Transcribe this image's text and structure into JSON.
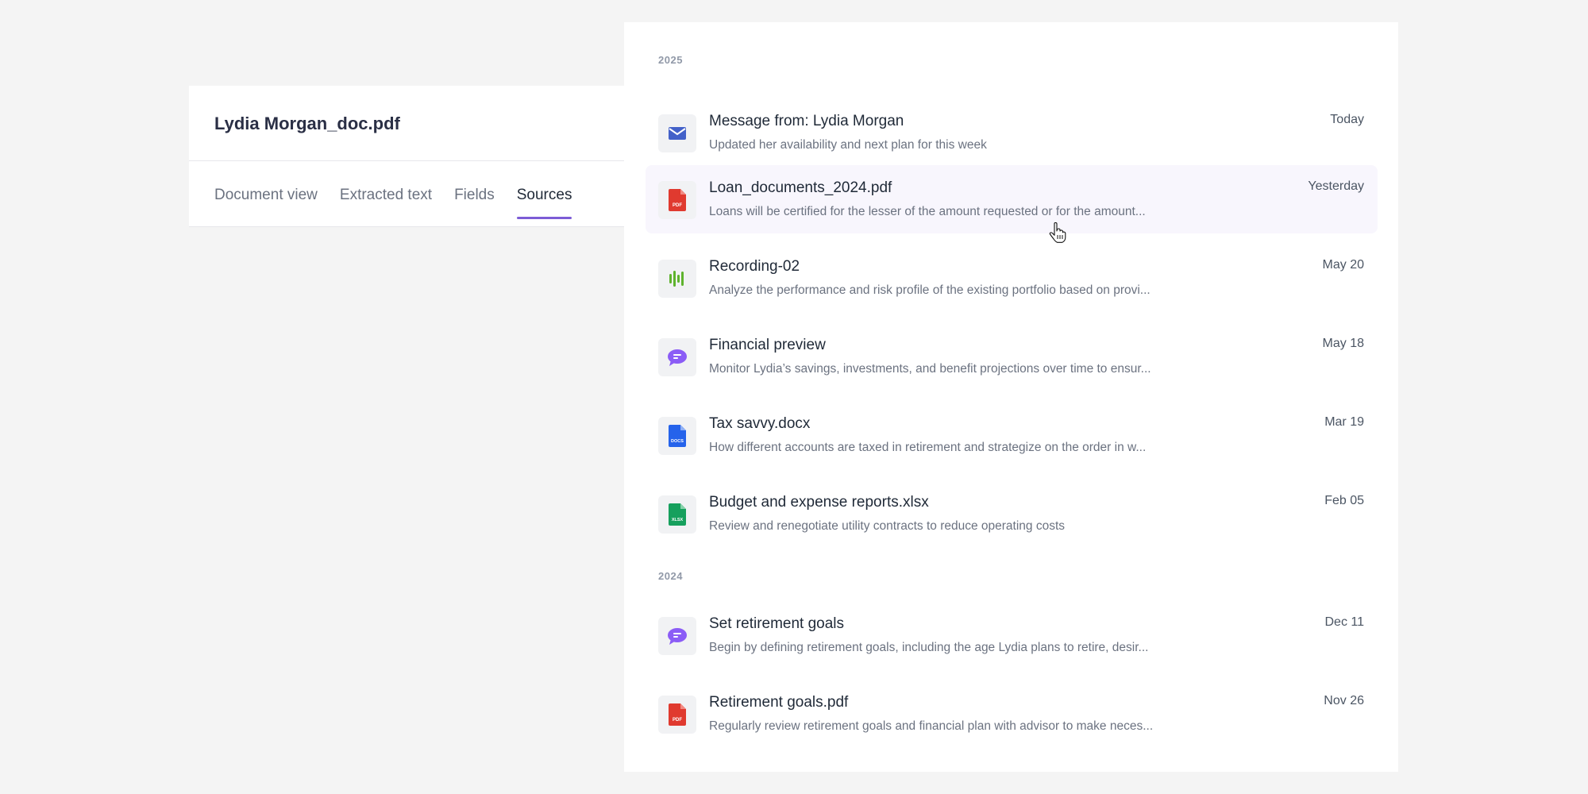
{
  "document": {
    "title": "Lydia Morgan_doc.pdf",
    "tabs": [
      {
        "label": "Document view"
      },
      {
        "label": "Extracted text"
      },
      {
        "label": "Fields"
      },
      {
        "label": "Sources"
      }
    ],
    "active_tab": "Sources"
  },
  "sources": {
    "groups": [
      {
        "year": "2025",
        "items": [
          {
            "icon": "mail-icon",
            "title": "Message from: Lydia Morgan",
            "description": "Updated her availability and next plan for this week",
            "date": "Today"
          },
          {
            "icon": "pdf-file-icon",
            "title": "Loan_documents_2024.pdf",
            "description": "Loans will be certified for the lesser of the amount requested or for the amount...",
            "date": "Yesterday"
          },
          {
            "icon": "audio-waveform-icon",
            "title": "Recording-02",
            "description": "Analyze the performance and risk profile of the existing portfolio based on provi...",
            "date": "May 20"
          },
          {
            "icon": "chat-bubble-icon",
            "title": "Financial preview",
            "description": "Monitor Lydia’s savings, investments, and benefit projections over time to ensur...",
            "date": "May 18"
          },
          {
            "icon": "docx-file-icon",
            "title": "Tax savvy.docx",
            "description": "How different accounts are taxed in retirement and strategize on the order in w...",
            "date": "Mar 19"
          },
          {
            "icon": "xlsx-file-icon",
            "title": "Budget and expense reports.xlsx",
            "description": "Review and renegotiate utility contracts to reduce operating costs",
            "date": "Feb 05"
          }
        ]
      },
      {
        "year": "2024",
        "items": [
          {
            "icon": "chat-bubble-icon",
            "title": "Set retirement goals",
            "description": "Begin by defining retirement goals, including the age Lydia plans to retire, desir...",
            "date": "Dec 11"
          },
          {
            "icon": "pdf-file-icon",
            "title": "Retirement goals.pdf",
            "description": "Regularly review retirement goals and financial plan with advisor to make neces...",
            "date": "Nov 26"
          }
        ]
      }
    ],
    "icon_labels": {
      "pdf": "PDF",
      "docx": "DOCS",
      "xlsx": "XLSX"
    }
  },
  "colors": {
    "accent": "#7c5cd6",
    "pdf": "#e03a2f",
    "docx": "#2563eb",
    "xlsx": "#16a05d",
    "audio": "#5fb32e",
    "mail": "#4361c9",
    "chat": "#8b5cf6"
  }
}
